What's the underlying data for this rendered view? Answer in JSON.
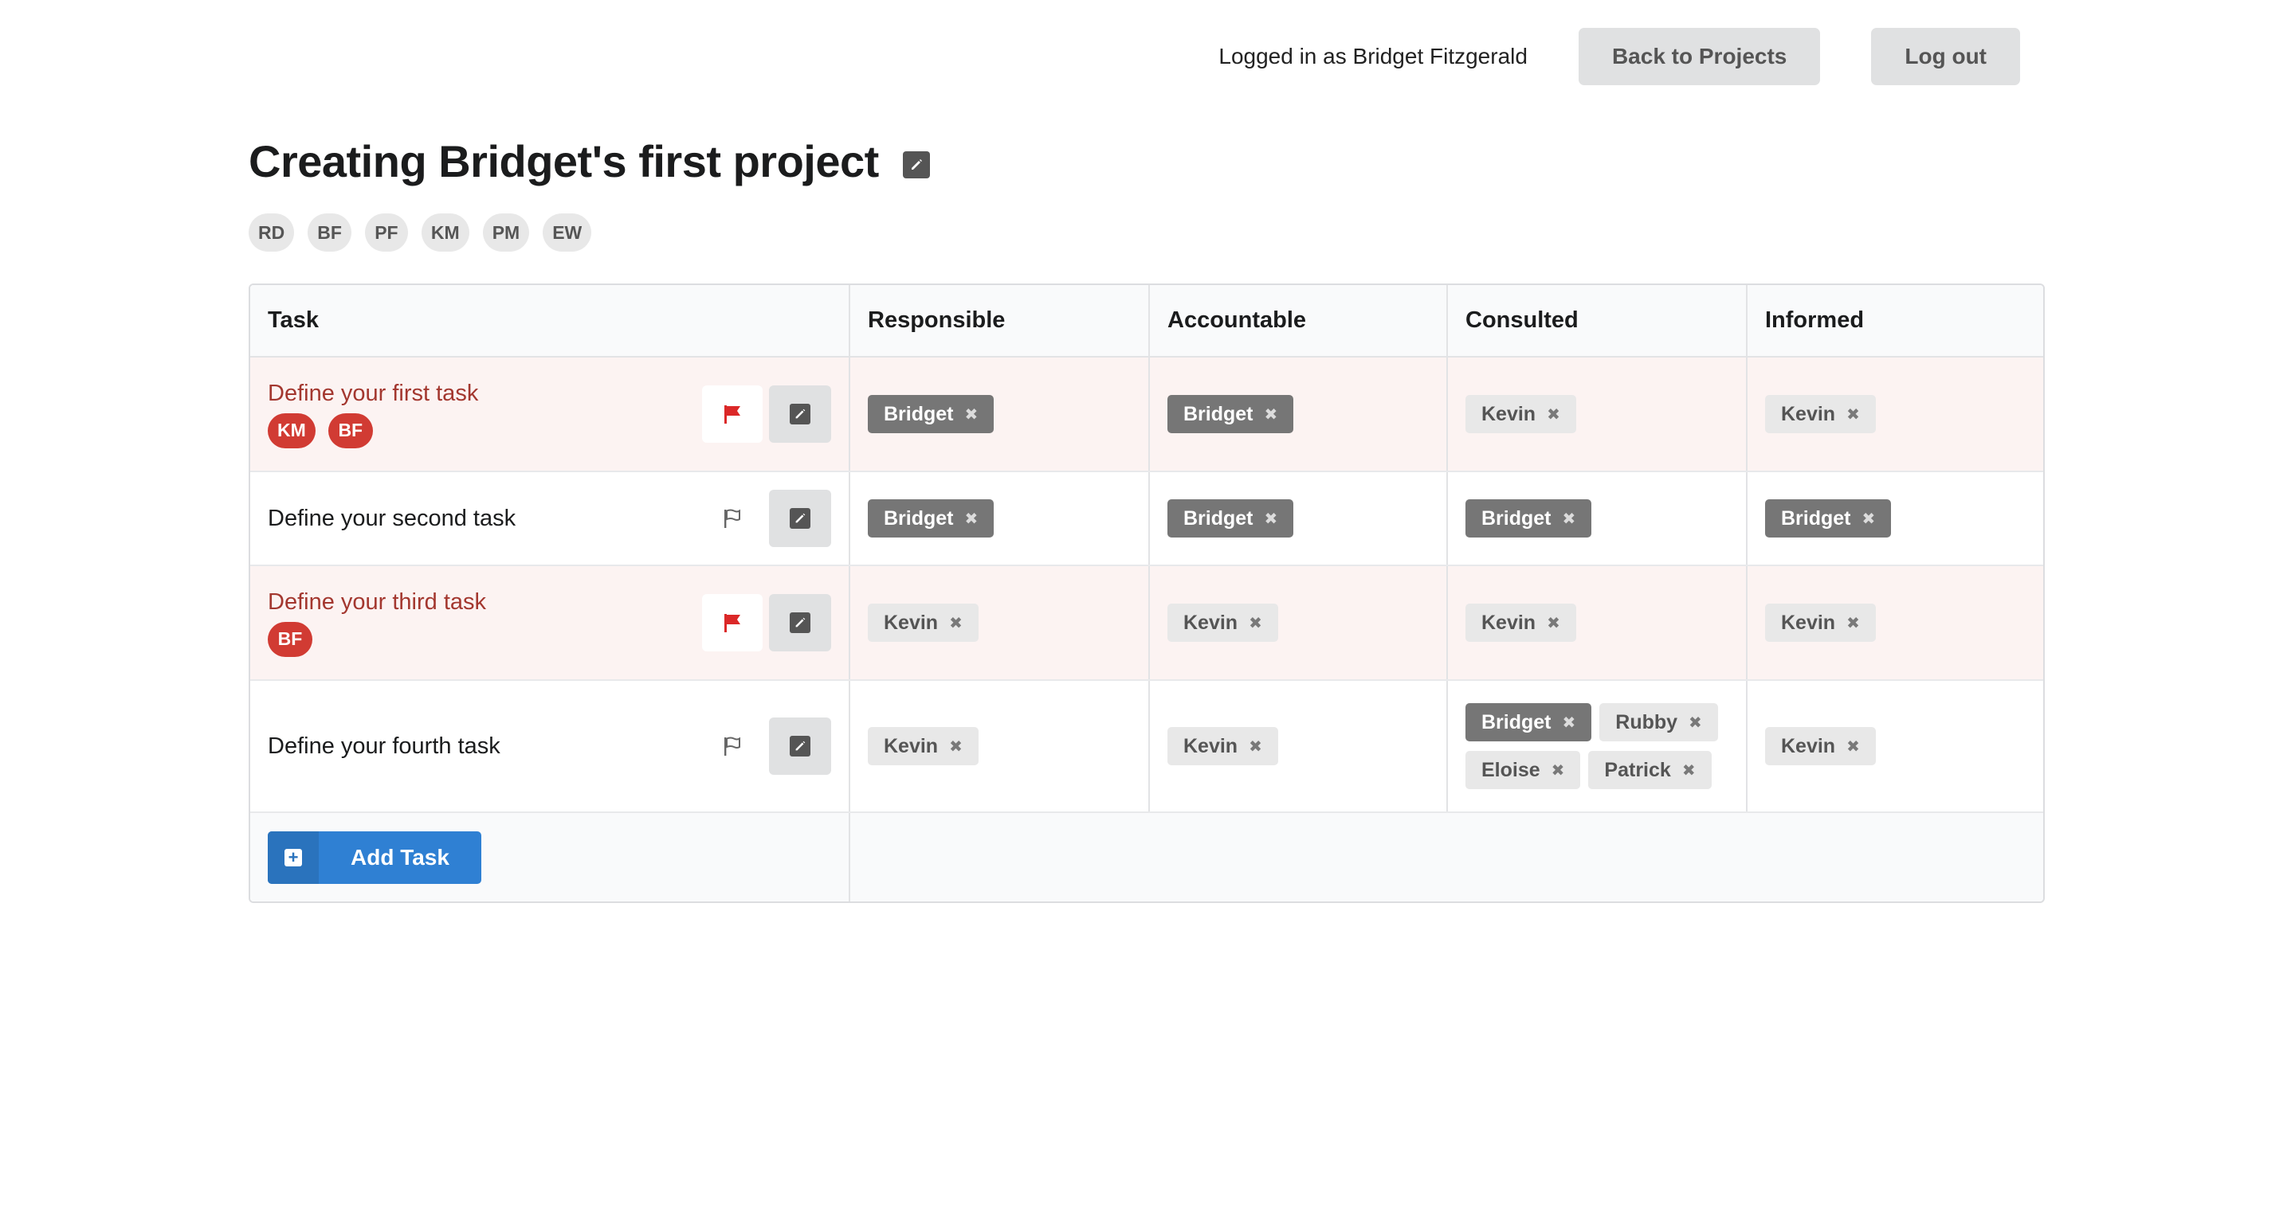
{
  "header": {
    "logged_in_text": "Logged in as Bridget Fitzgerald",
    "back_button": "Back to Projects",
    "logout_button": "Log out"
  },
  "project": {
    "title": "Creating Bridget's first project",
    "members": [
      "RD",
      "BF",
      "PF",
      "KM",
      "PM",
      "EW"
    ]
  },
  "table": {
    "columns": [
      "Task",
      "Responsible",
      "Accountable",
      "Consulted",
      "Informed"
    ],
    "rows": [
      {
        "task": "Define your first task",
        "flagged": true,
        "badges": [
          "KM",
          "BF"
        ],
        "responsible": [
          {
            "name": "Bridget",
            "style": "dark"
          }
        ],
        "accountable": [
          {
            "name": "Bridget",
            "style": "dark"
          }
        ],
        "consulted": [
          {
            "name": "Kevin",
            "style": "light"
          }
        ],
        "informed": [
          {
            "name": "Kevin",
            "style": "light"
          }
        ]
      },
      {
        "task": "Define your second task",
        "flagged": false,
        "badges": [],
        "responsible": [
          {
            "name": "Bridget",
            "style": "dark"
          }
        ],
        "accountable": [
          {
            "name": "Bridget",
            "style": "dark"
          }
        ],
        "consulted": [
          {
            "name": "Bridget",
            "style": "dark"
          }
        ],
        "informed": [
          {
            "name": "Bridget",
            "style": "dark"
          }
        ]
      },
      {
        "task": "Define your third task",
        "flagged": true,
        "badges": [
          "BF"
        ],
        "responsible": [
          {
            "name": "Kevin",
            "style": "light"
          }
        ],
        "accountable": [
          {
            "name": "Kevin",
            "style": "light"
          }
        ],
        "consulted": [
          {
            "name": "Kevin",
            "style": "light"
          }
        ],
        "informed": [
          {
            "name": "Kevin",
            "style": "light"
          }
        ]
      },
      {
        "task": "Define your fourth task",
        "flagged": false,
        "badges": [],
        "responsible": [
          {
            "name": "Kevin",
            "style": "light"
          }
        ],
        "accountable": [
          {
            "name": "Kevin",
            "style": "light"
          }
        ],
        "consulted": [
          {
            "name": "Bridget",
            "style": "dark"
          },
          {
            "name": "Rubby",
            "style": "light"
          },
          {
            "name": "Eloise",
            "style": "light"
          },
          {
            "name": "Patrick",
            "style": "light"
          }
        ],
        "informed": [
          {
            "name": "Kevin",
            "style": "light"
          }
        ]
      }
    ],
    "add_task_label": "Add Task"
  },
  "icons": {
    "flag_on": "flag-filled-icon",
    "flag_off": "flag-outline-icon",
    "edit": "edit-icon",
    "remove": "remove-x-icon",
    "plus": "plus-square-icon"
  },
  "colors": {
    "flag_red": "#db2828",
    "flagged_text": "#a3372f",
    "flagged_row_bg": "#fcf3f2",
    "badge_red": "#d13b33",
    "primary_blue": "#2f80d3",
    "label_dark": "#767676",
    "label_light": "#e8e8e8"
  }
}
